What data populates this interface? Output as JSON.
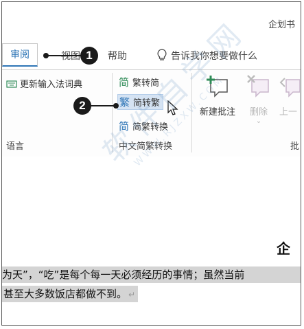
{
  "window": {
    "doc_title": "企划书"
  },
  "tabs": [
    {
      "label": "审阅",
      "active": true
    },
    {
      "label": "视图"
    },
    {
      "label": "帮助"
    }
  ],
  "tell_me": {
    "text": "告诉我你想要做什么"
  },
  "ribbon": {
    "language_group": {
      "update_ime_dict": "更新输入法词典",
      "label": "语言"
    },
    "chinese_conversion_group": {
      "to_simplified": "繁转简",
      "to_traditional": "简转繁",
      "conversion": "简繁转换",
      "label": "中文简繁转换"
    },
    "comments_group": {
      "new_comment": "新建批注",
      "delete": "删除",
      "previous": "上一",
      "label": "批"
    }
  },
  "callouts": {
    "one": "1",
    "two": "2"
  },
  "watermark": {
    "big": "软件自学网",
    "small": "WWW.RJZXW.COM"
  },
  "document": {
    "heading": "企",
    "lines": [
      "为天”，“吃”是每个每一天必须经历的事情；虽然当前",
      "甚至大多数饭店都做不到。"
    ],
    "para_mark": "↵"
  },
  "colors": {
    "accent": "#2e75b6",
    "highlight": "#d5e3f3",
    "selection": "#d4d4d4"
  }
}
